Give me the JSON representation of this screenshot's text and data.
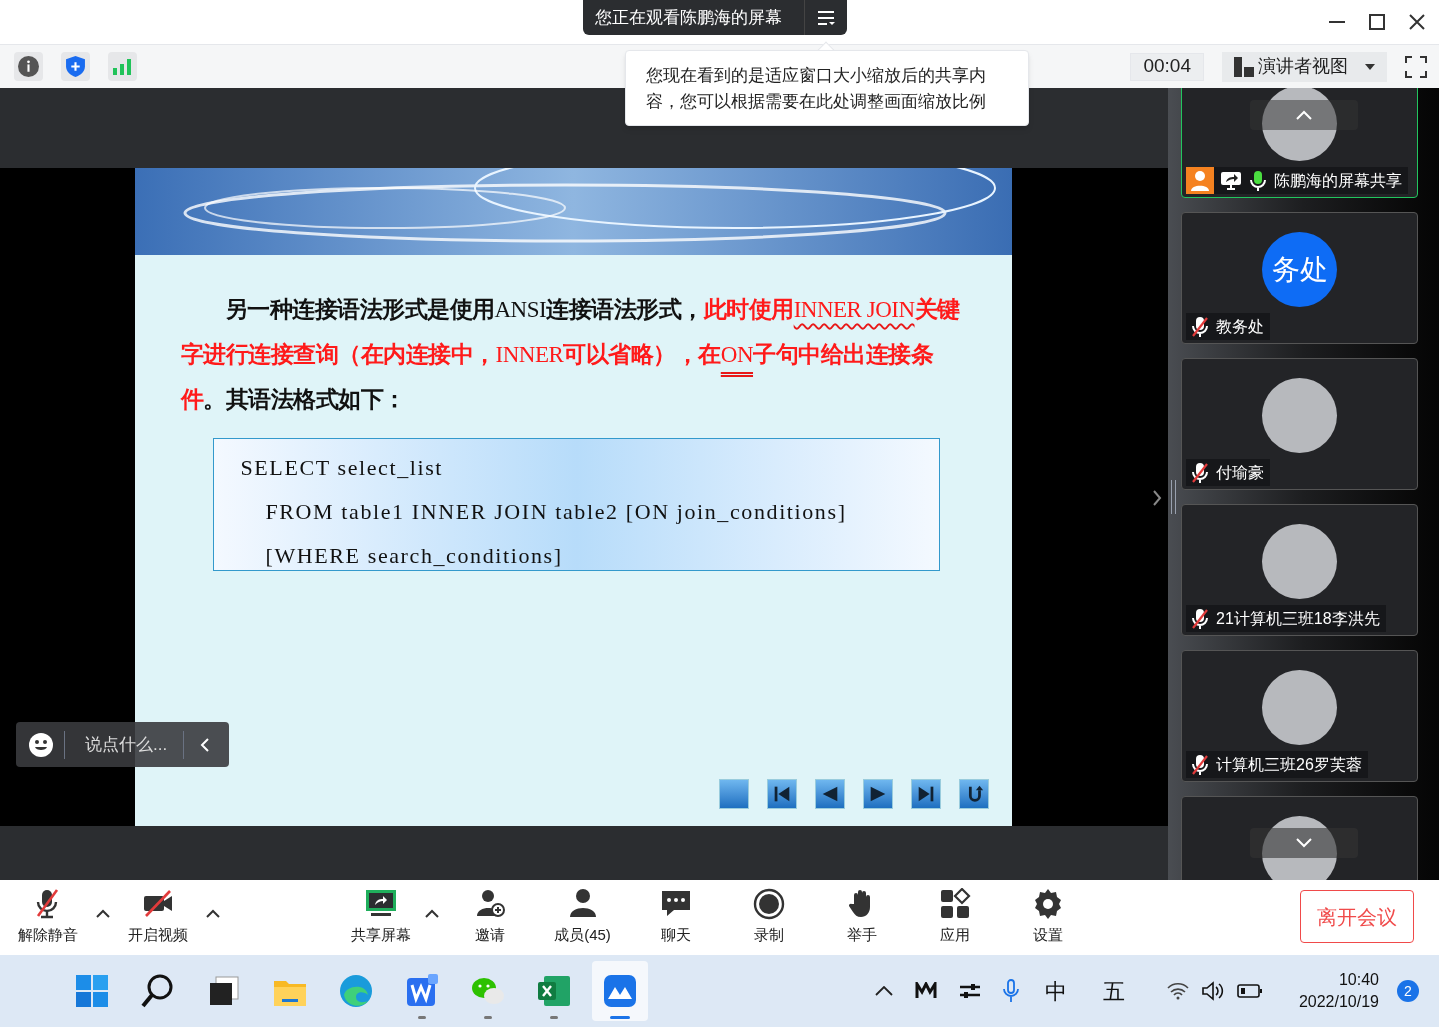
{
  "share_banner": {
    "text": "您正在观看陈鹏海的屏幕"
  },
  "top_bar": {
    "timer": "00:04",
    "view_button": "演讲者视图"
  },
  "tooltip": {
    "text": "您现在看到的是适应窗口大小缩放后的共享内容，您可以根据需要在此处调整画面缩放比例"
  },
  "slide": {
    "paragraph": [
      {
        "text": "另一种连接语法形式是使用",
        "highlight": false,
        "kind": "word"
      },
      {
        "text": "ANSI",
        "highlight": false,
        "kind": "term"
      },
      {
        "text": "连接语法形式，",
        "highlight": false,
        "kind": "word"
      },
      {
        "text": "此时使用",
        "highlight": true,
        "kind": "word"
      },
      {
        "text": "INNER JOIN",
        "highlight": true,
        "kind": "underlined_term"
      },
      {
        "text": "关键字进行连接查询（在内连接中，",
        "highlight": true,
        "kind": "word"
      },
      {
        "text": "INNER",
        "highlight": true,
        "kind": "term"
      },
      {
        "text": "可以省略），在",
        "highlight": true,
        "kind": "word"
      },
      {
        "text": "ON",
        "highlight": true,
        "kind": "double_underlined_term"
      },
      {
        "text": "子句中给出连接条件",
        "highlight": true,
        "kind": "word"
      },
      {
        "text": "。其语法格式如下：",
        "highlight": false,
        "kind": "word"
      }
    ],
    "code_lines": [
      {
        "text": "SELECT select_list",
        "indented": false
      },
      {
        "text": "FROM table1 INNER JOIN table2 [ON join_conditions]",
        "indented": true
      },
      {
        "text": "[WHERE search_conditions]",
        "indented": true
      }
    ],
    "nav_buttons": [
      {
        "kind": "blank"
      },
      {
        "kind": "first"
      },
      {
        "kind": "previous"
      },
      {
        "kind": "next"
      },
      {
        "kind": "last"
      },
      {
        "kind": "return"
      }
    ]
  },
  "chat_input": {
    "placeholder": "说点什么..."
  },
  "participants": [
    {
      "name": "陈鹏海的屏幕共享",
      "avatar": {
        "kind": "picture"
      },
      "muted": false,
      "host": true,
      "sharing": true,
      "active": true
    },
    {
      "name": "教务处",
      "avatar": {
        "kind": "text",
        "text": "务处"
      },
      "muted": true,
      "host": false,
      "sharing": false,
      "active": false
    },
    {
      "name": "付瑜豪",
      "avatar": {
        "kind": "picture"
      },
      "muted": true,
      "host": false,
      "sharing": false,
      "active": false
    },
    {
      "name": "21计算机三班18李洪先",
      "avatar": {
        "kind": "picture"
      },
      "muted": true,
      "host": false,
      "sharing": false,
      "active": false
    },
    {
      "name": "计算机三班26罗芙蓉",
      "avatar": {
        "kind": "picture"
      },
      "muted": true,
      "host": false,
      "sharing": false,
      "active": false
    },
    {
      "avatar": {
        "kind": "picture"
      },
      "active": false
    }
  ],
  "toolbar": [
    {
      "label": "解除静音",
      "kind": "mic_off",
      "has_menu": true
    },
    {
      "label": "开启视频",
      "kind": "video_off",
      "has_menu": true
    },
    {
      "label": "共享屏幕",
      "kind": "share",
      "has_menu": true
    },
    {
      "label": "邀请",
      "kind": "invite",
      "has_menu": false
    },
    {
      "label": "成员(45)",
      "kind": "members",
      "has_menu": false
    },
    {
      "label": "聊天",
      "kind": "chat",
      "has_menu": false
    },
    {
      "label": "录制",
      "kind": "record",
      "has_menu": false
    },
    {
      "label": "举手",
      "kind": "hand",
      "has_menu": false
    },
    {
      "label": "应用",
      "kind": "apps",
      "has_menu": false
    },
    {
      "label": "设置",
      "kind": "settings",
      "has_menu": false
    }
  ],
  "leave_button": "离开会议",
  "taskbar": {
    "apps": [
      {
        "kind": "start",
        "running": false,
        "selected": false
      },
      {
        "kind": "search",
        "running": false,
        "selected": false
      },
      {
        "kind": "taskview",
        "running": false,
        "selected": false
      },
      {
        "kind": "files",
        "running": false,
        "selected": false
      },
      {
        "kind": "browser",
        "running": false,
        "selected": false
      },
      {
        "kind": "writer",
        "running": true,
        "selected": false
      },
      {
        "kind": "chat",
        "running": true,
        "selected": false
      },
      {
        "kind": "sheet",
        "running": true,
        "selected": false
      },
      {
        "kind": "meeting",
        "running": true,
        "selected": true
      }
    ],
    "input_method": "中",
    "input_mode": "五",
    "time": "10:40",
    "date": "2022/10/19",
    "notifications": "2"
  }
}
